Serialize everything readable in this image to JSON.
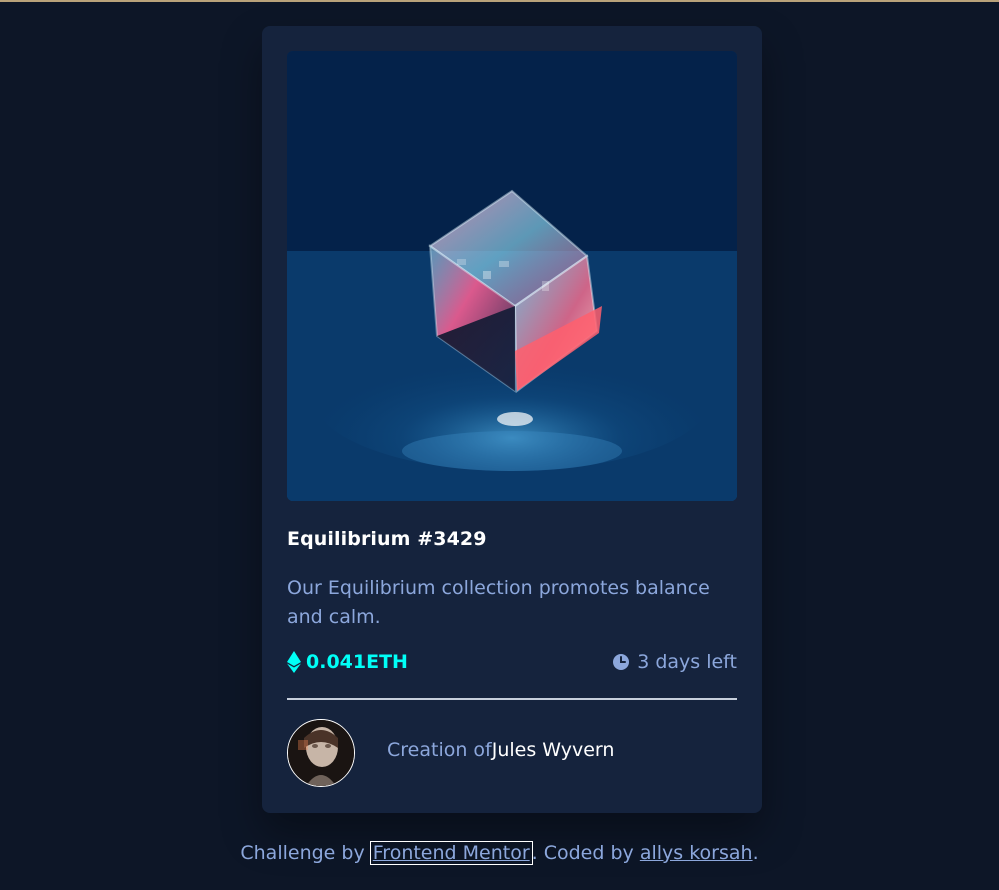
{
  "card": {
    "title": "Equilibrium #3429",
    "description": "Our Equilibrium collection promotes balance and calm.",
    "price": "0.041ETH",
    "time_left": "3 days left",
    "creator_prefix": "Creation of",
    "creator_name": "Jules Wyvern",
    "image_icon": "equilibrium-cube-image",
    "avatar_icon": "creator-avatar-image"
  },
  "footer": {
    "prefix": "Challenge by ",
    "link1": "Frontend Mentor",
    "middle": ". Coded by ",
    "link2": "allys korsah",
    "suffix": "."
  },
  "colors": {
    "background": "#0d1627",
    "card": "#15233d",
    "accent_cyan": "#00fff7",
    "soft_blue": "#8ca7dc",
    "white": "#ffffff"
  },
  "icons": {
    "price": "ethereum-icon",
    "time": "clock-icon"
  }
}
